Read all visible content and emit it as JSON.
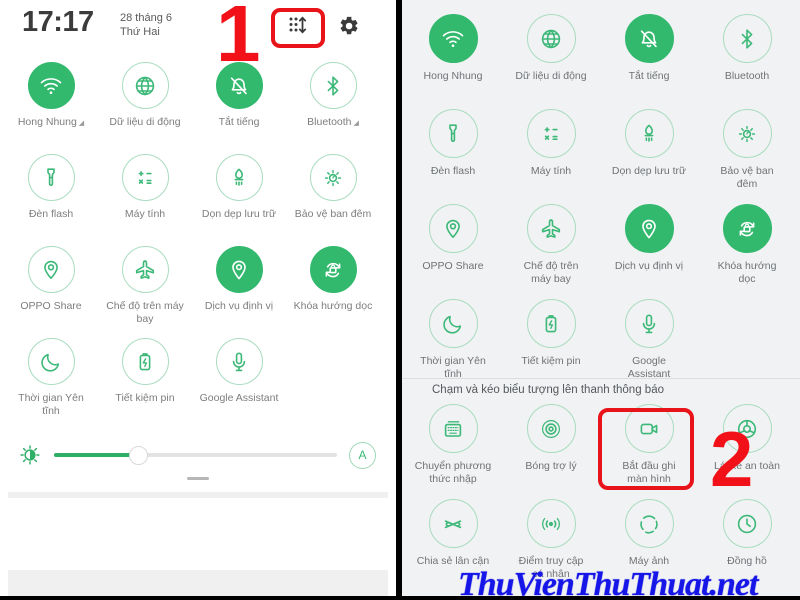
{
  "annotations": {
    "step_one": "1",
    "step_two": "2"
  },
  "watermark": {
    "text": "ThuVienThuThuat.net"
  },
  "left_panel": {
    "status": {
      "clock": "17:17",
      "date": "28 tháng 6",
      "weekday": "Thứ Hai",
      "edit_icon": "reorder-tiles-icon",
      "settings_icon": "gear-icon"
    },
    "tiles": [
      {
        "label": "Hong Nhung",
        "icon": "wifi-icon",
        "active": true,
        "expand": true
      },
      {
        "label": "Dữ liệu di động",
        "icon": "globe-icon",
        "active": false,
        "expand": false
      },
      {
        "label": "Tắt tiếng",
        "icon": "bell-muted-icon",
        "active": true,
        "expand": false
      },
      {
        "label": "Bluetooth",
        "icon": "bluetooth-icon",
        "active": false,
        "expand": true
      },
      {
        "label": "Đèn flash",
        "icon": "flashlight-icon",
        "active": false,
        "expand": false
      },
      {
        "label": "Máy tính",
        "icon": "calculator-icon",
        "active": false,
        "expand": false
      },
      {
        "label": "Dọn dẹp lưu trữ",
        "icon": "storage-clean-icon",
        "active": false,
        "expand": false
      },
      {
        "label": "Bảo vệ ban đêm",
        "icon": "night-shield-icon",
        "active": false,
        "expand": false
      },
      {
        "label": "OPPO Share",
        "icon": "oppo-share-icon",
        "active": false,
        "expand": false
      },
      {
        "label": "Chế độ trên máy\nbay",
        "icon": "airplane-icon",
        "active": false,
        "expand": false
      },
      {
        "label": "Dịch vụ định vị",
        "icon": "location-pin-icon",
        "active": true,
        "expand": false
      },
      {
        "label": "Khóa hướng dọc",
        "icon": "rotation-lock-icon",
        "active": true,
        "expand": false
      },
      {
        "label": "Thời gian Yên\ntĩnh",
        "icon": "moon-icon",
        "active": false,
        "expand": false
      },
      {
        "label": "Tiết kiệm pin",
        "icon": "battery-saver-icon",
        "active": false,
        "expand": false
      },
      {
        "label": "Google Assistant",
        "icon": "microphone-icon",
        "active": false,
        "expand": false
      }
    ],
    "brightness": {
      "icon": "brightness-icon",
      "value_percent": 30,
      "auto_label": "A"
    }
  },
  "right_panel": {
    "tiles": [
      {
        "label": "Hong Nhung",
        "icon": "wifi-icon",
        "active": true
      },
      {
        "label": "Dữ liệu di động",
        "icon": "globe-icon",
        "active": false
      },
      {
        "label": "Tắt tiếng",
        "icon": "bell-muted-icon",
        "active": true
      },
      {
        "label": "Bluetooth",
        "icon": "bluetooth-icon",
        "active": false
      },
      {
        "label": "Đèn flash",
        "icon": "flashlight-icon",
        "active": false
      },
      {
        "label": "Máy tính",
        "icon": "calculator-icon",
        "active": false
      },
      {
        "label": "Dọn dẹp lưu trữ",
        "icon": "storage-clean-icon",
        "active": false
      },
      {
        "label": "Bảo vệ ban\nđêm",
        "icon": "night-shield-icon",
        "active": false
      },
      {
        "label": "OPPO Share",
        "icon": "oppo-share-icon",
        "active": false
      },
      {
        "label": "Chế độ trên\nmáy bay",
        "icon": "airplane-icon",
        "active": false
      },
      {
        "label": "Dịch vụ định vị",
        "icon": "location-pin-icon",
        "active": true
      },
      {
        "label": "Khóa hướng\ndọc",
        "icon": "rotation-lock-icon",
        "active": true
      },
      {
        "label": "Thời gian Yên\ntĩnh",
        "icon": "moon-icon",
        "active": false
      },
      {
        "label": "Tiết kiệm pin",
        "icon": "battery-saver-icon",
        "active": false
      },
      {
        "label": "Google\nAssistant",
        "icon": "microphone-icon",
        "active": false
      }
    ],
    "drawer": {
      "hint": "Chạm và kéo biểu tượng lên thanh thông báo",
      "tiles": [
        {
          "label": "Chuyển phương\nthức nhập",
          "icon": "keyboard-switch-icon",
          "active": false
        },
        {
          "label": "Bóng trợ lý",
          "icon": "assistive-ball-icon",
          "active": false
        },
        {
          "label": "Bắt đầu ghi\nmàn hình",
          "icon": "screen-record-icon",
          "active": false,
          "highlighted": true
        },
        {
          "label": "Lái xe an toàn",
          "icon": "safe-drive-icon",
          "active": false
        },
        {
          "label": "Chia sẻ lân cận",
          "icon": "nearby-share-icon",
          "active": false
        },
        {
          "label": "Điểm truy cập\ncá nhân",
          "icon": "hotspot-icon",
          "active": false
        },
        {
          "label": "Máy ảnh",
          "icon": "camera-shutter-icon",
          "active": false
        },
        {
          "label": "Đồng hồ",
          "icon": "clock-icon",
          "active": false
        }
      ]
    }
  },
  "colors": {
    "tile_active": "#32b96e",
    "tile_outline": "#a9dcc0",
    "icon_green": "#3cb878",
    "annotation_red": "#f21118",
    "watermark_blue": "#1616e8",
    "panel_bg_right": "#f1f2f3"
  }
}
